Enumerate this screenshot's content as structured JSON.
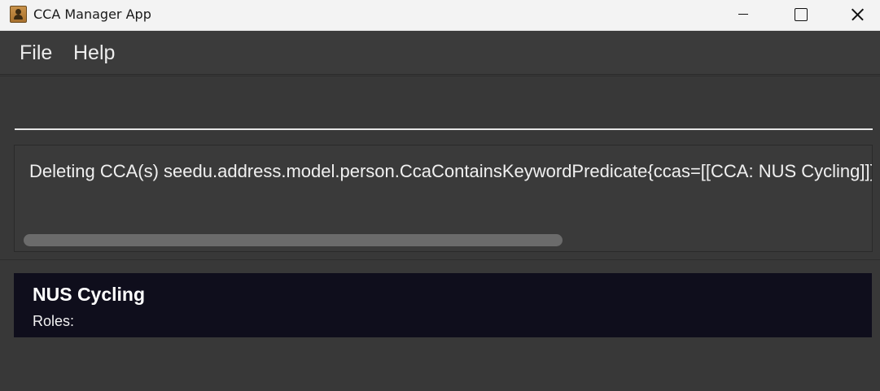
{
  "window": {
    "title": "CCA Manager App",
    "icon": "contact-book-icon"
  },
  "menu": {
    "items": [
      {
        "label": "File"
      },
      {
        "label": "Help"
      }
    ]
  },
  "command_box": {
    "value": "",
    "placeholder": ""
  },
  "result_display": {
    "text": "Deleting CCA(s) seedu.address.model.person.CcaContainsKeywordPredicate{ccas=[[CCA: NUS Cycling]]}"
  },
  "cca_list": {
    "items": [
      {
        "name": "NUS Cycling",
        "roles_label": "Roles:"
      }
    ]
  },
  "colors": {
    "background": "#383838",
    "card_background": "#0f0e1c",
    "titlebar": "#f3f3f3"
  }
}
